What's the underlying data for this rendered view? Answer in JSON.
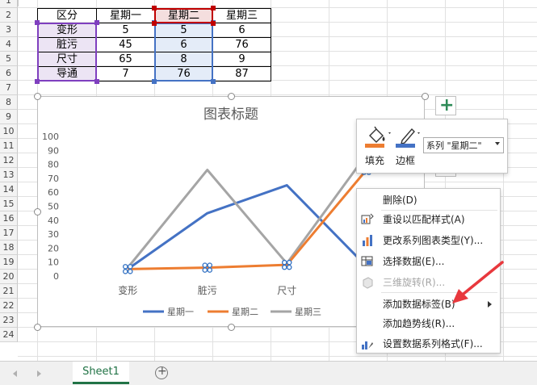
{
  "sheet": {
    "row_numbers": [
      "1",
      "2",
      "3",
      "4",
      "5",
      "6",
      "7",
      "8",
      "9",
      "10",
      "11",
      "12",
      "13",
      "14",
      "15",
      "16",
      "17",
      "18",
      "19",
      "20",
      "21",
      "22",
      "23",
      "24"
    ],
    "tab_name": "Sheet1",
    "add_sheet_icon": "plus-circle-icon",
    "nav_prev_icon": "triangle-left-icon",
    "nav_next_icon": "triangle-right-icon"
  },
  "table": {
    "headers": [
      "区分",
      "星期一",
      "星期二",
      "星期三"
    ],
    "rows": [
      [
        "变形",
        "5",
        "5",
        "6"
      ],
      [
        "脏污",
        "45",
        "6",
        "76"
      ],
      [
        "尺寸",
        "65",
        "8",
        "9"
      ],
      [
        "导通",
        "7",
        "76",
        "87"
      ]
    ],
    "highlight_colors": {
      "category": "#7f3fbf",
      "series": "#4472c4",
      "header": "#c00000"
    }
  },
  "chart_data": {
    "type": "line",
    "title": "图表标题",
    "categories": [
      "变形",
      "脏污",
      "尺寸",
      "导通"
    ],
    "series": [
      {
        "name": "星期一",
        "values": [
          5,
          45,
          65,
          7
        ],
        "color": "#4472c4"
      },
      {
        "name": "星期二",
        "values": [
          5,
          6,
          8,
          76
        ],
        "color": "#ed7d31"
      },
      {
        "name": "星期三",
        "values": [
          6,
          76,
          9,
          87
        ],
        "color": "#a5a5a5"
      }
    ],
    "y_ticks": [
      "0",
      "10",
      "20",
      "30",
      "40",
      "50",
      "60",
      "70",
      "80",
      "90",
      "100"
    ],
    "ylim": [
      0,
      100
    ],
    "legend_position": "bottom",
    "grid": false
  },
  "format_popup": {
    "fill_label": "填充",
    "border_label": "边框",
    "series_selector": "系列 \"星期二\"",
    "fill_icon": "paint-bucket-icon",
    "border_icon": "pen-icon",
    "fill_color": "#ed7d31",
    "border_color": "#4472c4"
  },
  "chart_side_buttons": {
    "add_element_icon": "plus-icon"
  },
  "context_menu": {
    "items": [
      {
        "label": "删除(D)",
        "icon": "none",
        "disabled": false
      },
      {
        "label": "重设以匹配样式(A)",
        "icon": "reset-style-icon",
        "disabled": false
      },
      {
        "label": "更改系列图表类型(Y)...",
        "icon": "bar-chart-icon",
        "disabled": false
      },
      {
        "label": "选择数据(E)...",
        "icon": "table-select-icon",
        "disabled": false
      },
      {
        "label": "三维旋转(R)...",
        "icon": "cube-3d-icon",
        "disabled": true
      },
      {
        "label": "添加数据标签(B)",
        "icon": "none",
        "disabled": false,
        "submenu": true
      },
      {
        "label": "添加趋势线(R)...",
        "icon": "none",
        "disabled": false
      },
      {
        "label": "设置数据系列格式(F)...",
        "icon": "format-series-icon",
        "disabled": false
      }
    ]
  },
  "annotation": {
    "arrow_color": "#e8383d"
  }
}
